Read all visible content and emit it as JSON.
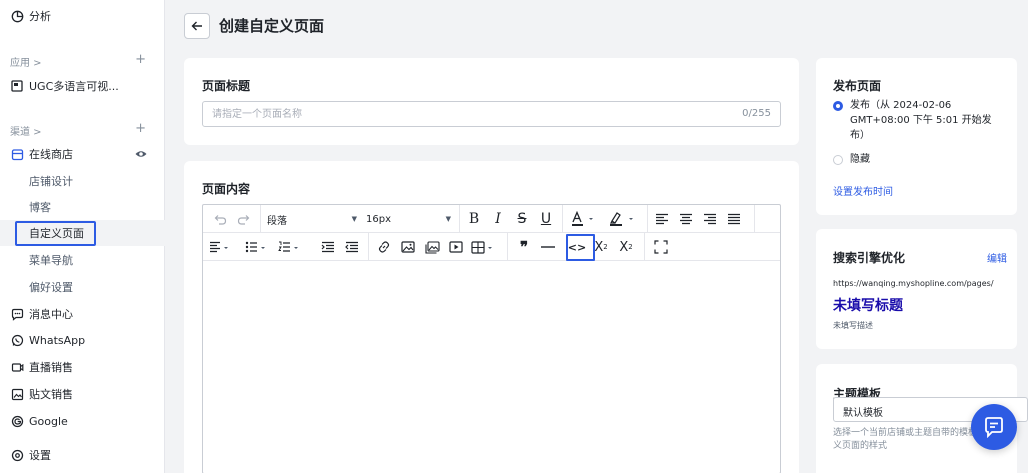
{
  "sidebar": {
    "analytics": "分析",
    "apps_section": "应用 >",
    "apps_plus": "+",
    "ugc_app": "UGC多语言可视...",
    "channels_section": "渠道 >",
    "channels_plus": "+",
    "online_store": "在线商店",
    "store_items": [
      "店铺设计",
      "博客",
      "自定义页面",
      "菜单导航",
      "偏好设置"
    ],
    "message_center": "消息中心",
    "whatsapp": "WhatsApp",
    "live_sales": "直播销售",
    "post_sales": "贴文销售",
    "google": "Google",
    "settings": "设置"
  },
  "header": {
    "title": "创建自定义页面"
  },
  "page_title_card": {
    "title": "页面标题",
    "placeholder": "请指定一个页面名称",
    "counter": "0/255"
  },
  "content_card": {
    "title": "页面内容",
    "paragraph_select": "段落",
    "font_size_select": "16px"
  },
  "publish_card": {
    "title": "发布页面",
    "publish_option_line1": "发布（从 2024-02-06",
    "publish_option_line2": "GMT+08:00 下午 5:01 开始发",
    "publish_option_line3": "布）",
    "hide_option": "隐藏",
    "set_time_link": "设置发布时间",
    "publish_selected": true
  },
  "seo_card": {
    "title": "搜索引擎优化",
    "edit_link": "编辑",
    "url": "https://wanqing.myshopline.com/pages/",
    "preview_title": "未填写标题",
    "preview_desc": "未填写描述"
  },
  "theme_card": {
    "title": "主题模板",
    "selected": "默认模板",
    "help": "选择一个当前店铺或主题自带的模板文件来定义页面的样式"
  },
  "colors": {
    "accent": "#2d5be3",
    "seo_title": "#1a0dab"
  }
}
